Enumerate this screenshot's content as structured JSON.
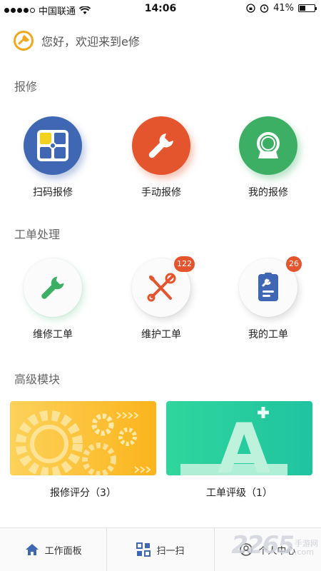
{
  "status_bar": {
    "carrier": "中国联通",
    "time": "14:06",
    "battery": "41%",
    "battery_level": 0.41
  },
  "greeting": "您好，欢迎来到e修",
  "sections": {
    "repair": {
      "title": "报修",
      "items": [
        {
          "label": "扫码报修",
          "icon": "qr-scan-icon"
        },
        {
          "label": "手动报修",
          "icon": "wrench-icon"
        },
        {
          "label": "我的报修",
          "icon": "camera-icon"
        }
      ]
    },
    "work_orders": {
      "title": "工单处理",
      "items": [
        {
          "label": "维修工单",
          "icon": "wrench-icon",
          "badge": ""
        },
        {
          "label": "维护工单",
          "icon": "tools-icon",
          "badge": "122"
        },
        {
          "label": "我的工单",
          "icon": "clipboard-icon",
          "badge": "26"
        }
      ]
    },
    "advanced": {
      "title": "高级模块",
      "cards": [
        {
          "label": "报修评分（3）",
          "color": "#fbb41c"
        },
        {
          "label": "工单评级（1）",
          "color": "#2fd69c"
        }
      ],
      "card_glyph": "A"
    }
  },
  "tabbar": {
    "items": [
      {
        "label": "工作面板",
        "icon": "home-icon"
      },
      {
        "label": "扫一扫",
        "icon": "scan-icon"
      },
      {
        "label": "个人中心",
        "icon": "user-icon"
      }
    ]
  },
  "watermark": {
    "number": "2265",
    "line1": "手游网",
    "line2": ".com"
  },
  "colors": {
    "blue": "#3f67b4",
    "orange": "#e4552e",
    "green": "#3caf64",
    "accent_yellow": "#fbb41c"
  }
}
